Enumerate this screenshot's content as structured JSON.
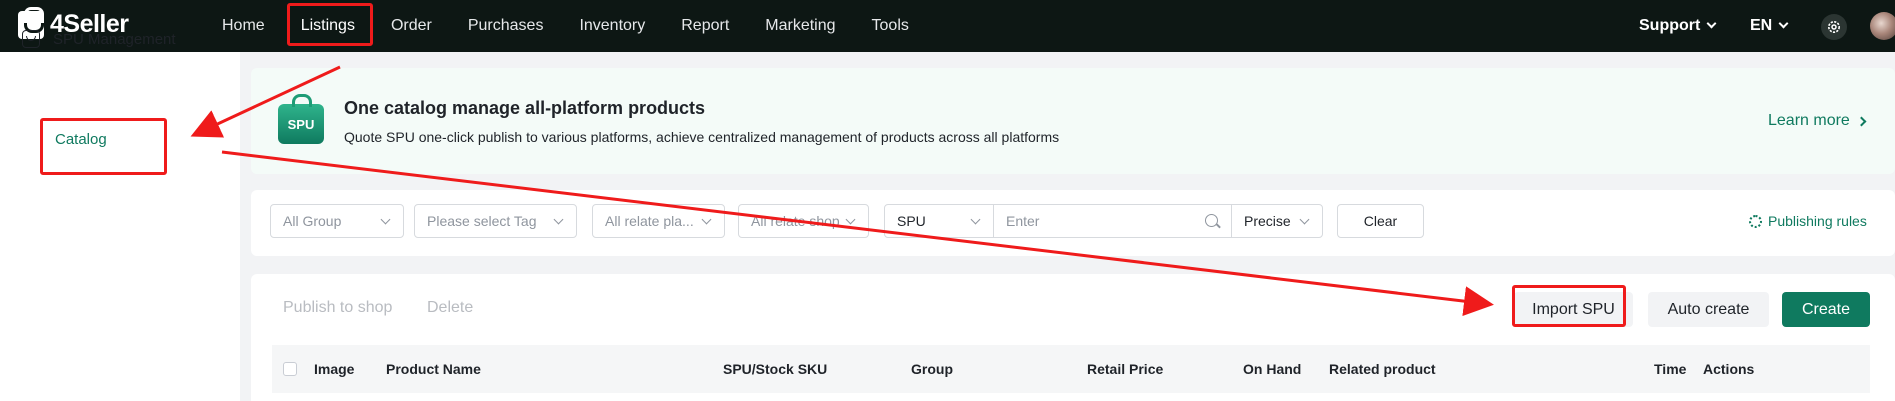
{
  "brand": {
    "name": "4Seller"
  },
  "nav": {
    "items": [
      "Home",
      "Listings",
      "Order",
      "Purchases",
      "Inventory",
      "Report",
      "Marketing",
      "Tools"
    ],
    "active": "Listings",
    "support": "Support",
    "language": "EN"
  },
  "sidebar": {
    "group": "SPU Management",
    "items": [
      {
        "label": "Catalog",
        "active": true
      }
    ]
  },
  "banner": {
    "badge": "SPU",
    "title": "One catalog manage all-platform products",
    "subtitle": "Quote SPU one-click publish to various platforms, achieve centralized management of products across all platforms",
    "link": "Learn more"
  },
  "filters": {
    "group": "All Group",
    "tag": "Please select Tag",
    "platform": "All relate pla...",
    "shop": "All relate shop",
    "field": "SPU",
    "search_placeholder": "Enter",
    "match": "Precise",
    "clear": "Clear",
    "publishing_rules": "Publishing rules"
  },
  "toolbar": {
    "publish": "Publish to shop",
    "delete": "Delete",
    "import": "Import SPU",
    "auto_create": "Auto create",
    "create": "Create"
  },
  "table": {
    "columns": [
      "Image",
      "Product Name",
      "SPU/Stock SKU",
      "Group",
      "Retail Price",
      "On Hand",
      "Related product",
      "Time",
      "Actions"
    ]
  },
  "colors": {
    "brand_green": "#0f7a5f",
    "topbar": "#0d1714",
    "annotation_red": "#ef1b1b"
  }
}
